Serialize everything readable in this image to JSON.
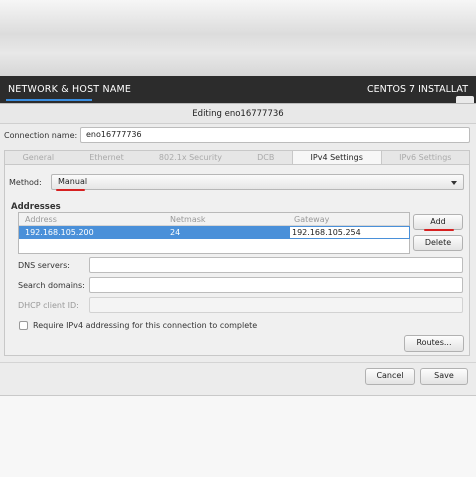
{
  "banner": {
    "title": "NETWORK & HOST NAME",
    "right_title": "CENTOS 7 INSTALLAT"
  },
  "dialog": {
    "title": "Editing eno16777736",
    "connection_name_label": "Connection name:",
    "connection_name_value": "eno16777736"
  },
  "tabs": [
    {
      "label": "General"
    },
    {
      "label": "Ethernet"
    },
    {
      "label": "802.1x Security"
    },
    {
      "label": "DCB"
    },
    {
      "label": "IPv4 Settings"
    },
    {
      "label": "IPv6 Settings"
    }
  ],
  "ipv4": {
    "method_label": "Method:",
    "method_value": "Manual",
    "addresses_title": "Addresses",
    "columns": [
      "Address",
      "Netmask",
      "Gateway"
    ],
    "row": {
      "address": "192.168.105.200",
      "netmask": "24",
      "gateway": "192.168.105.254"
    },
    "add_label": "Add",
    "delete_label": "Delete",
    "dns_label": "DNS servers:",
    "dns_value": "",
    "search_label": "Search domains:",
    "search_value": "",
    "dhcp_label": "DHCP client ID:",
    "dhcp_value": "",
    "require_label": "Require IPv4 addressing for this connection to complete",
    "require_checked": false,
    "routes_label": "Routes..."
  },
  "footer": {
    "cancel_label": "Cancel",
    "save_label": "Save"
  },
  "colors": {
    "selection": "#4a90d9",
    "annotation": "#d62020",
    "banner": "#2c2c2c"
  }
}
